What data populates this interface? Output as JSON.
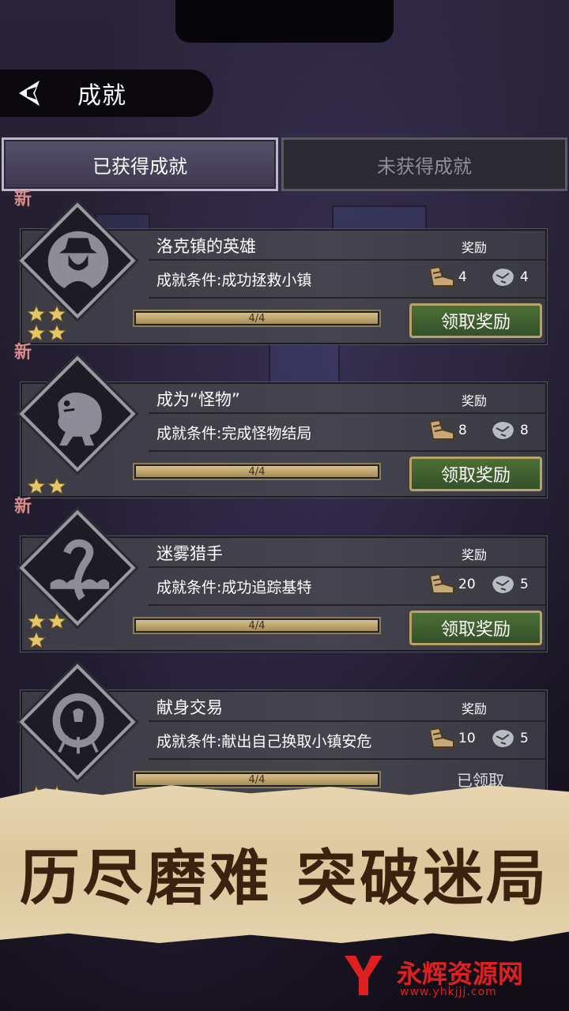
{
  "header": {
    "title": "成就"
  },
  "tabs": [
    {
      "label": "已获得成就",
      "active": true
    },
    {
      "label": "未获得成就",
      "active": false
    }
  ],
  "achievements": [
    {
      "new_tag": "新",
      "name": "洛克镇的英雄",
      "condition": "成就条件:成功拯救小镇",
      "reward_label": "奖励",
      "reward1": "4",
      "reward2": "4",
      "progress_text": "4/4",
      "progress": 1.0,
      "stars": 4,
      "action": "领取奖励",
      "icon": "hat-man-icon"
    },
    {
      "new_tag": "新",
      "name": "成为“怪物”",
      "condition": "成就条件:完成怪物结局",
      "reward_label": "奖励",
      "reward1": "8",
      "reward2": "8",
      "progress_text": "4/4",
      "progress": 1.0,
      "stars": 2,
      "action": "领取奖励",
      "icon": "monster-icon"
    },
    {
      "new_tag": "新",
      "name": "迷雾猎手",
      "condition": "成就条件:成功追踪基特",
      "reward_label": "奖励",
      "reward1": "20",
      "reward2": "5",
      "progress_text": "4/4",
      "progress": 1.0,
      "stars": 3,
      "action": "领取奖励",
      "icon": "serpent-icon"
    },
    {
      "new_tag": "",
      "name": "献身交易",
      "condition": "成就条件:献出自己换取小镇安危",
      "reward_label": "奖励",
      "reward1": "10",
      "reward2": "5",
      "progress_text": "4/4",
      "progress": 1.0,
      "stars": 2,
      "action": "已领取",
      "icon": "sacrifice-icon"
    }
  ],
  "banner": {
    "text": "历尽磨难 突破迷局"
  },
  "watermark": {
    "text": "永辉资源网",
    "url_text": "www.yhkjjj.com"
  },
  "colors": {
    "accent_green": "#3e5e2f",
    "gold_border": "#b8a266",
    "new_tag": "#d98a8a"
  }
}
